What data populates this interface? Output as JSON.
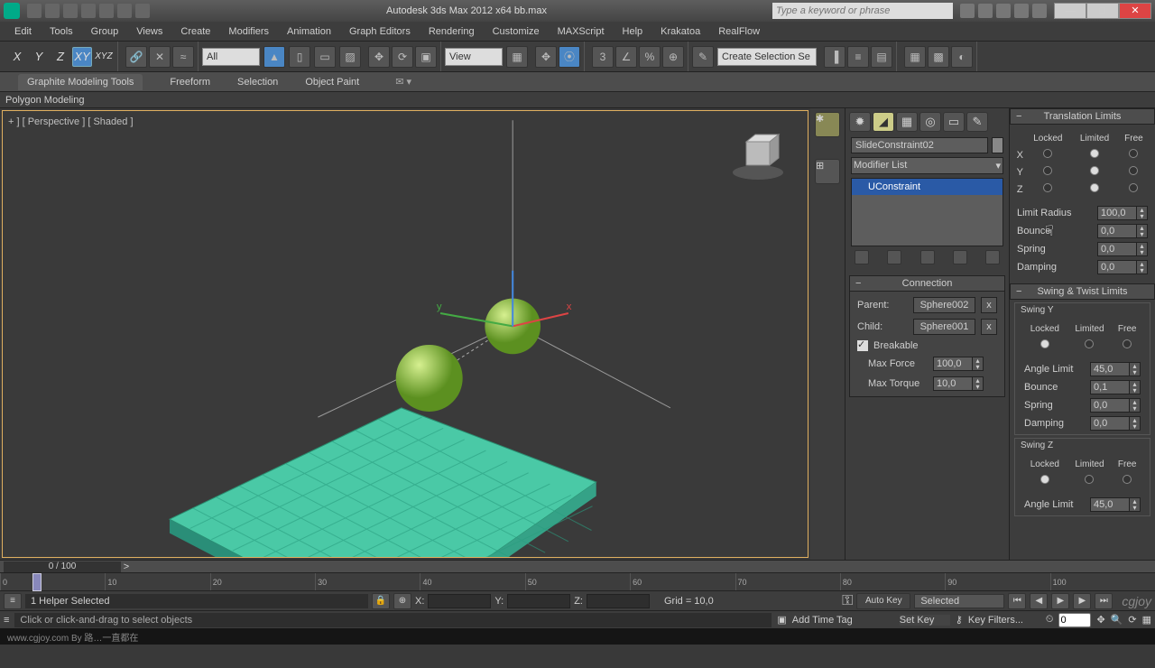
{
  "title": "Autodesk 3ds Max  2012 x64     bb.max",
  "search_placeholder": "Type a keyword or phrase",
  "menus": [
    "Edit",
    "Tools",
    "Group",
    "Views",
    "Create",
    "Modifiers",
    "Animation",
    "Graph Editors",
    "Rendering",
    "Customize",
    "MAXScript",
    "Help",
    "Krakatoa",
    "RealFlow"
  ],
  "axes": [
    "X",
    "Y",
    "Z",
    "XY",
    "XYZ"
  ],
  "toolbar": {
    "all": "All",
    "view": "View",
    "named_sel": "Create Selection Se"
  },
  "ribbon": {
    "tabs": [
      "Graphite Modeling Tools",
      "Freeform",
      "Selection",
      "Object Paint"
    ],
    "sub": "Polygon Modeling"
  },
  "viewport_label": "+ ] [ Perspective ] [ Shaded ]",
  "object_name": "SlideConstraint02",
  "modlist_label": "Modifier List",
  "modstack_item": "UConstraint",
  "connection": {
    "title": "Connection",
    "parent_label": "Parent:",
    "parent_btn": "Sphere002",
    "child_label": "Child:",
    "child_btn": "Sphere001",
    "breakable": "Breakable",
    "max_force_label": "Max Force",
    "max_force": "100,0",
    "max_torque_label": "Max Torque",
    "max_torque": "10,0"
  },
  "translation": {
    "title": "Translation Limits",
    "cols": [
      "Locked",
      "Limited",
      "Free"
    ],
    "rows": [
      "X",
      "Y",
      "Z"
    ],
    "limit_radius_label": "Limit Radius",
    "limit_radius": "100,0",
    "bounce_label": "Bounce",
    "bounce": "0,0",
    "spring_label": "Spring",
    "spring": "0,0",
    "damping_label": "Damping",
    "damping": "0,0"
  },
  "swing": {
    "title": "Swing & Twist Limits",
    "y_title": "Swing Y",
    "z_title": "Swing Z",
    "cols": [
      "Locked",
      "Limited",
      "Free"
    ],
    "angle_label": "Angle Limit",
    "angle_y": "45,0",
    "angle_z": "45,0",
    "bounce_label": "Bounce",
    "bounce_y": "0,1",
    "spring_label": "Spring",
    "spring_y": "0,0",
    "damping_label": "Damping",
    "damping_y": "0,0"
  },
  "timeline": {
    "slider": "0 / 100",
    "arrow": ">",
    "ticks": [
      "0",
      "10",
      "20",
      "30",
      "40",
      "50",
      "60",
      "70",
      "80",
      "90",
      "100"
    ]
  },
  "status": {
    "sel": "1 Helper Selected",
    "x": "X:",
    "y": "Y:",
    "z": "Z:",
    "grid": "Grid = 10,0",
    "autokey": "Auto Key",
    "setkey": "Set Key",
    "selected": "Selected",
    "keyfilters": "Key Filters...",
    "frame": "0"
  },
  "prompt": "Click or click-and-drag to select objects",
  "time_tag": "Add Time Tag",
  "footer": "www.cgjoy.com By 路…一直都在",
  "watermark": "cgjoy"
}
